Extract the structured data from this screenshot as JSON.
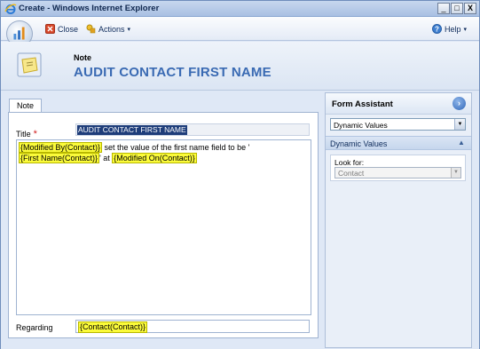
{
  "window": {
    "title": "Create - Windows Internet Explorer",
    "minimize_glyph": "_",
    "maximize_glyph": "□",
    "close_glyph": "X"
  },
  "toolbar": {
    "close_label": "Close",
    "actions_label": "Actions",
    "actions_caret": "▾",
    "help_label": "Help",
    "help_caret": "▾"
  },
  "header": {
    "entity_type": "Note",
    "record_title": "AUDIT CONTACT FIRST NAME"
  },
  "form": {
    "tab_label": "Note",
    "title_label": "Title",
    "required_marker": "*",
    "title_value": "AUDIT CONTACT FIRST NAME",
    "description": {
      "line1_slug": "{Modified By(Contact)}",
      "line1_text": " set the value of the first name field to be '",
      "line2_slug1": "{First Name(Contact)}",
      "line2_text": "' at ",
      "line2_slug2": "{Modified On(Contact)}"
    },
    "regarding_label": "Regarding",
    "regarding_value": "{Contact(Contact)}"
  },
  "form_assistant": {
    "title": "Form Assistant",
    "toggle_glyph": "›",
    "dropdown_value": "Dynamic Values",
    "section_label": "Dynamic Values",
    "section_glyph": "▲",
    "look_for_label": "Look for:",
    "look_for_value": "Contact"
  },
  "colors": {
    "accent_title": "#3a6ab3",
    "slug_highlight": "#fbfb3a",
    "required": "#d02020",
    "selection": "#1e3d7a"
  },
  "icons": [
    "ie-icon",
    "crm-logo-icon",
    "close-icon",
    "actions-icon",
    "help-icon",
    "note-entity-icon",
    "chevron-right-icon",
    "dropdown-arrow-icon",
    "collapse-icon"
  ]
}
